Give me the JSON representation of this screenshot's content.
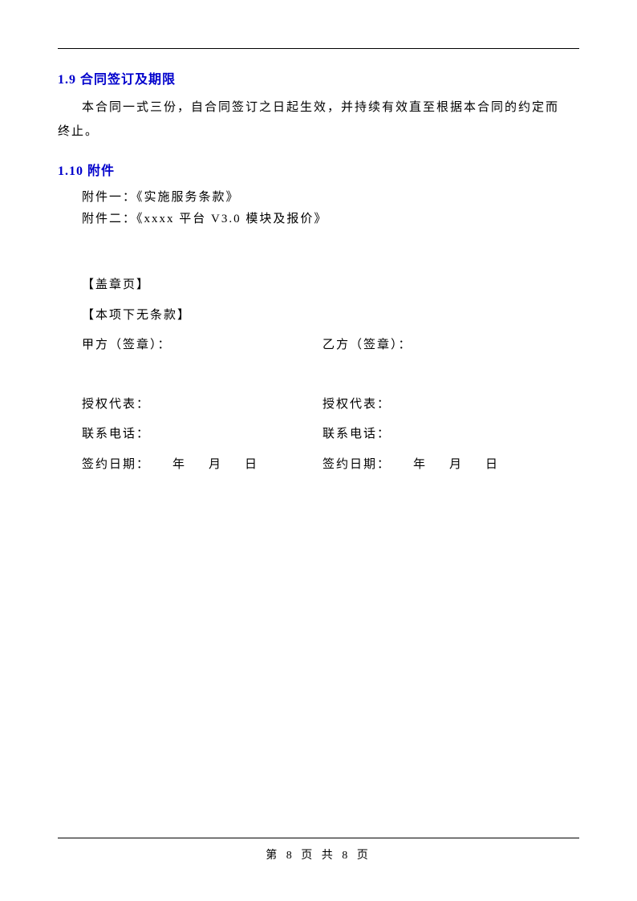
{
  "section19": {
    "heading": "1.9 合同签订及期限",
    "body_line1": "本合同一式三份，自合同签订之日起生效，并持续有效直至根据本合同的约定而",
    "body_line2": "终止。"
  },
  "section110": {
    "heading": "1.10 附件",
    "attachment1": "附件一：《实施服务条款》",
    "attachment2": "附件二：《xxxx 平台 V3.0 模块及报价》"
  },
  "seal": {
    "page_label": "【盖章页】",
    "no_clause": "【本项下无条款】",
    "party_a_sig": "甲方（签章）：",
    "party_b_sig": "乙方（签章）：",
    "auth_rep": "授权代表：",
    "contact_phone": "联系电话：",
    "sign_date_label": "签约日期：",
    "year": "年",
    "month": "月",
    "day": "日"
  },
  "footer": {
    "page_number": "第 8 页 共 8 页"
  }
}
